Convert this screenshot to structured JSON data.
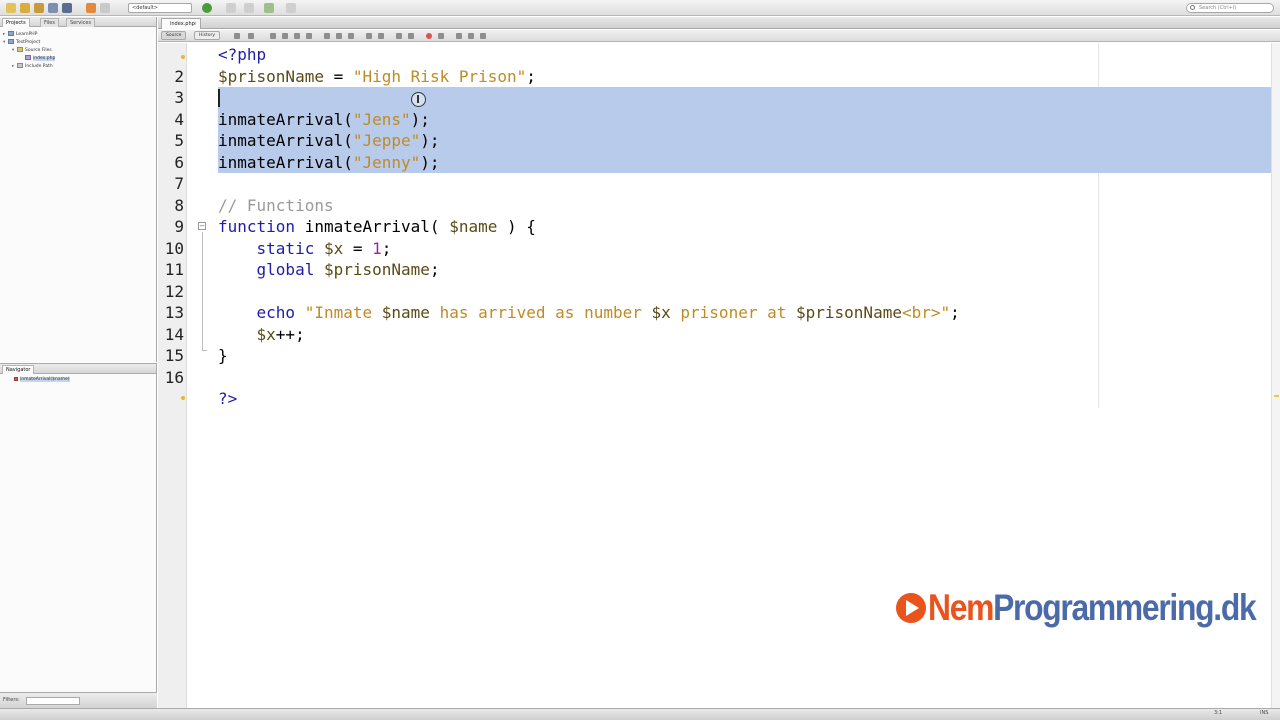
{
  "toolbar": {
    "config_value": "<default>",
    "search_placeholder": "Search (Ctrl+I)"
  },
  "projects_panel": {
    "tabs": [
      "Projects",
      "Files",
      "Services"
    ],
    "tree": [
      {
        "label": "LearnPHP",
        "depth": 0
      },
      {
        "label": "TestProject",
        "depth": 0
      },
      {
        "label": "Source Files",
        "depth": 1
      },
      {
        "label": "index.php",
        "depth": 2
      },
      {
        "label": "Include Path",
        "depth": 1
      }
    ]
  },
  "navigator_panel": {
    "title": "Navigator",
    "items": [
      "inmateArrival($name)"
    ],
    "filter_label": "Filters:"
  },
  "editor": {
    "file_tab": "index.php",
    "view_tabs": [
      "Source",
      "History"
    ],
    "lines": [
      {
        "n": "",
        "html": "<span class='kw'>&lt;?php</span>",
        "sel": false
      },
      {
        "n": "2",
        "html": "<span class='var'>$prisonName</span> = <span class='str'>\"High Risk Prison\"</span>;",
        "sel": false
      },
      {
        "n": "3",
        "html": "",
        "sel": true
      },
      {
        "n": "4",
        "html": "inmateArrival(<span class='str'>\"Jens\"</span>);",
        "sel": true
      },
      {
        "n": "5",
        "html": "inmateArrival(<span class='str'>\"Jeppe\"</span>);",
        "sel": true
      },
      {
        "n": "6",
        "html": "inmateArrival(<span class='str'>\"Jenny\"</span>);",
        "sel": true
      },
      {
        "n": "7",
        "html": "",
        "sel": false
      },
      {
        "n": "8",
        "html": "<span class='cmt'>// Functions</span>",
        "sel": false
      },
      {
        "n": "9",
        "html": "<span class='kw'>function</span> inmateArrival( <span class='var'>$name</span> ) {",
        "sel": false
      },
      {
        "n": "10",
        "html": "    <span class='kw'>static</span> <span class='var'>$x</span> = <span class='num'>1</span>;",
        "sel": false
      },
      {
        "n": "11",
        "html": "    <span class='kw'>global</span> <span class='var'>$prisonName</span>;",
        "sel": false
      },
      {
        "n": "12",
        "html": "",
        "sel": false
      },
      {
        "n": "13",
        "html": "    <span class='kw'>echo</span> <span class='str'>\"Inmate </span><span class='var'>$name</span><span class='str'> has arrived as number </span><span class='var'>$x</span><span class='str'> prisoner at </span><span class='var'>$prisonName</span><span class='str'>&lt;br&gt;\"</span>;",
        "sel": false
      },
      {
        "n": "14",
        "html": "    <span class='var'>$x</span>++;",
        "sel": false
      },
      {
        "n": "15",
        "html": "}",
        "sel": false
      },
      {
        "n": "16",
        "html": "",
        "sel": false
      },
      {
        "n": "",
        "html": "<span class='kw'>?&gt;</span>",
        "sel": false
      }
    ]
  },
  "watermark": {
    "part1": "Nem",
    "part2": "Programmering.dk",
    "brand_orange": "#e8541c",
    "brand_blue": "#4b6aa8"
  },
  "statusbar": {
    "position": "3:1",
    "mode": "INS"
  }
}
